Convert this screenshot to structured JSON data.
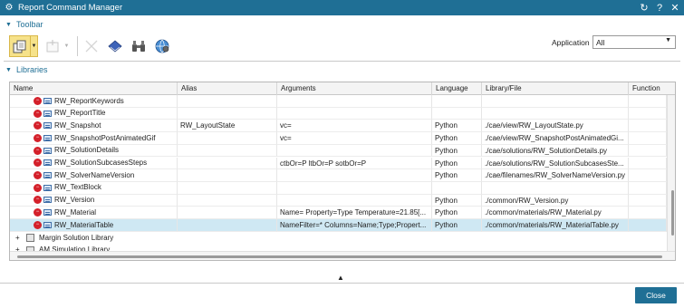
{
  "window": {
    "title": "Report Command Manager",
    "controls": [
      "↻",
      "?",
      "✕"
    ]
  },
  "toolbar_section": {
    "label": "Toolbar"
  },
  "toolbar": {
    "buttons": [
      {
        "name": "new-library-button",
        "icon": "library-icon",
        "state": "active",
        "dropdown": true
      },
      {
        "name": "add-command-button",
        "icon": "add-icon",
        "state": "disabled",
        "dropdown": true
      },
      {
        "name": "delete-button",
        "icon": "delete-icon",
        "state": "disabled"
      },
      {
        "name": "edit-button",
        "icon": "book-icon",
        "state": "enabled"
      },
      {
        "name": "find-button",
        "icon": "binoculars-icon",
        "state": "enabled"
      },
      {
        "name": "web-button",
        "icon": "globe-icon",
        "state": "enabled"
      }
    ]
  },
  "application": {
    "label": "Application",
    "selected": "All"
  },
  "libraries_section": {
    "label": "Libraries"
  },
  "table": {
    "columns": [
      "Name",
      "Alias",
      "Arguments",
      "Language",
      "Library/File",
      "Function"
    ],
    "rows": [
      {
        "name": "RW_ReportKeywords",
        "alias": "",
        "args": "",
        "lang": "",
        "file": "",
        "func": ""
      },
      {
        "name": "RW_ReportTitle",
        "alias": "",
        "args": "",
        "lang": "",
        "file": "",
        "func": ""
      },
      {
        "name": "RW_Snapshot",
        "alias": "RW_LayoutState",
        "args": "vc=",
        "lang": "Python",
        "file": "./cae/view/RW_LayoutState.py",
        "func": ""
      },
      {
        "name": "RW_SnapshotPostAnimatedGif",
        "alias": "",
        "args": "vc=",
        "lang": "Python",
        "file": "./cae/view/RW_SnapshotPostAnimatedGi...",
        "func": ""
      },
      {
        "name": "RW_SolutionDetails",
        "alias": "",
        "args": "",
        "lang": "Python",
        "file": "./cae/solutions/RW_SolutionDetails.py",
        "func": ""
      },
      {
        "name": "RW_SolutionSubcasesSteps",
        "alias": "",
        "args": "ctbOr=P ltbOr=P sotbOr=P",
        "lang": "Python",
        "file": "./cae/solutions/RW_SolutionSubcasesSte...",
        "func": ""
      },
      {
        "name": "RW_SolverNameVersion",
        "alias": "",
        "args": "",
        "lang": "Python",
        "file": "./cae/filenames/RW_SolverNameVersion.py",
        "func": ""
      },
      {
        "name": "RW_TextBlock",
        "alias": "",
        "args": "",
        "lang": "",
        "file": "",
        "func": ""
      },
      {
        "name": "RW_Version",
        "alias": "",
        "args": "",
        "lang": "Python",
        "file": "./common/RW_Version.py",
        "func": ""
      },
      {
        "name": "RW_Material",
        "alias": "",
        "args": "Name= Property=Type Temperature=21.85[...",
        "lang": "Python",
        "file": "./common/materials/RW_Material.py",
        "func": ""
      },
      {
        "name": "RW_MaterialTable",
        "alias": "",
        "args": "NameFilter=* Columns=Name;Type;Propert...",
        "lang": "Python",
        "file": "./common/materials/RW_MaterialTable.py",
        "func": "",
        "selected": true
      }
    ],
    "libraries": [
      {
        "name": "Margin Solution Library"
      },
      {
        "name": "AM Simulation Library"
      }
    ]
  },
  "footer": {
    "close_label": "Close"
  }
}
